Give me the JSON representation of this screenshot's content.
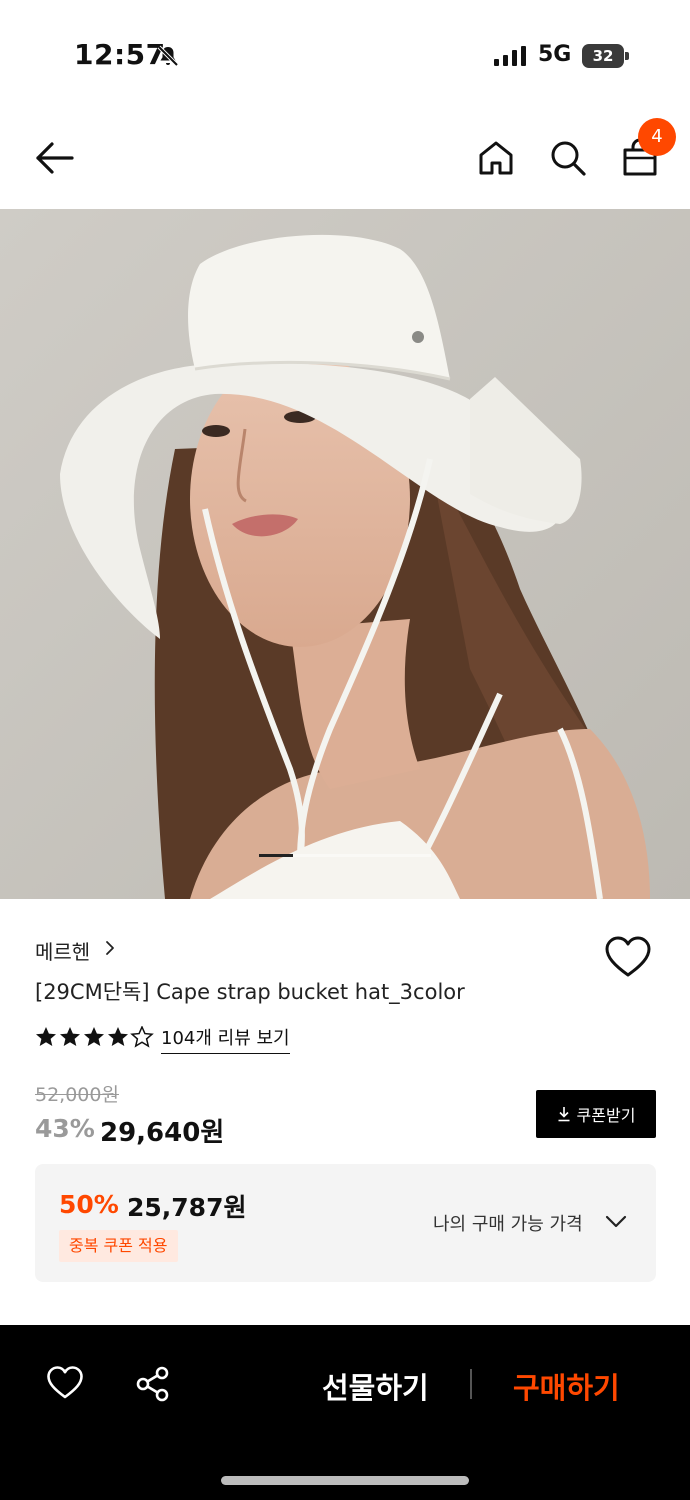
{
  "status_bar": {
    "time": "12:57",
    "network": "5G",
    "battery": "32"
  },
  "header": {
    "cart_count": "4",
    "icons": [
      "arrow-left-icon",
      "home-icon",
      "search-icon",
      "shopping-bag-icon"
    ]
  },
  "product": {
    "brand": "메르헨",
    "title": "[29CM단독] Cape strap bucket hat_3color",
    "rating": 4.5,
    "review_link": "104개 리뷰 보기",
    "original_price": "52,000원",
    "discount_rate": "43%",
    "sale_price": "29,640원",
    "coupon_button": "쿠폰받기",
    "image_page": 1,
    "image_count": 5
  },
  "best_price": {
    "rate": "50%",
    "price": "25,787원",
    "tag": "중복 쿠폰 적용",
    "toggle_label": "나의 구매 가능 가격"
  },
  "bottom_bar": {
    "gift_label": "선물하기",
    "buy_label": "구매하기"
  },
  "colors": {
    "accent": "#ff4800",
    "bottom_bar_bg": "#000000",
    "price_box_bg": "#f4f4f4"
  }
}
